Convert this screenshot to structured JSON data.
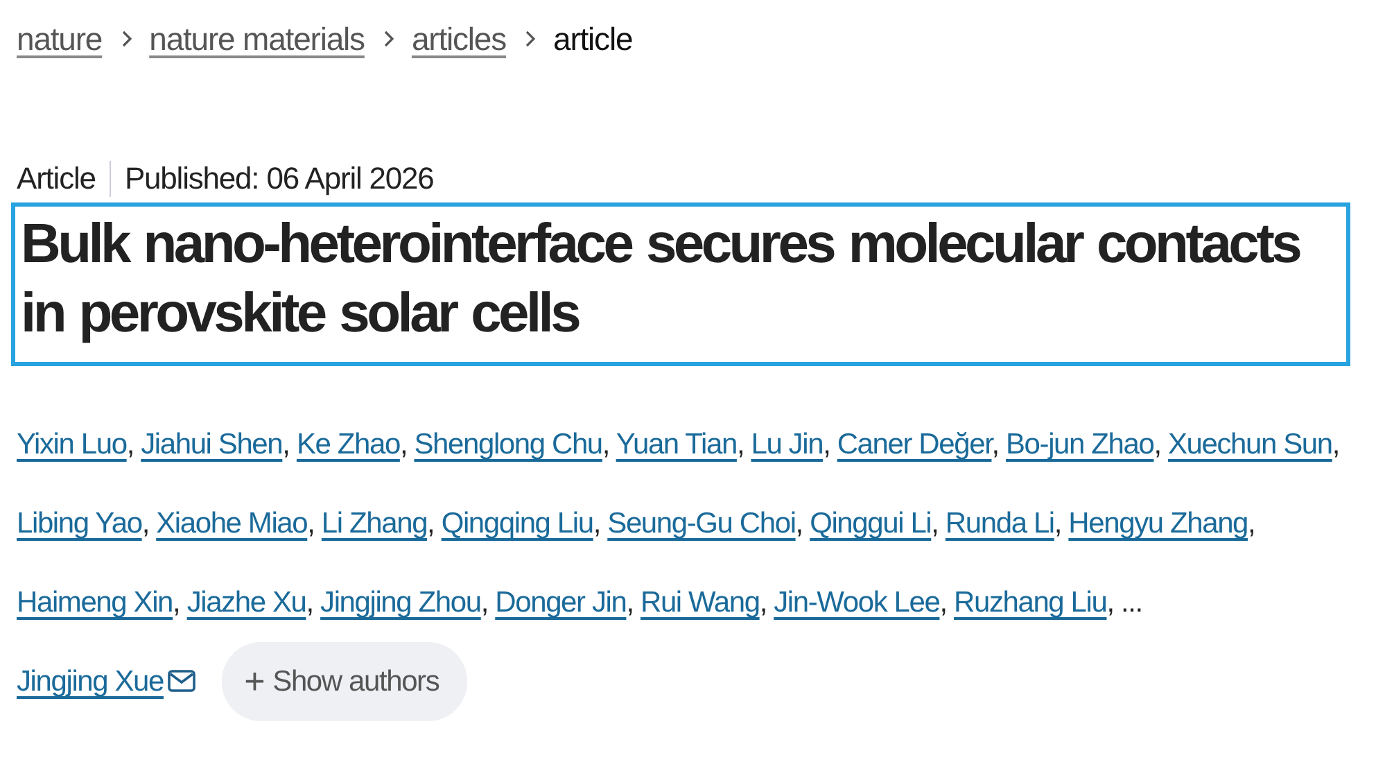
{
  "breadcrumb": [
    {
      "label": "nature",
      "link": true
    },
    {
      "label": "nature materials",
      "link": true
    },
    {
      "label": "articles",
      "link": true
    },
    {
      "label": "article",
      "link": false
    }
  ],
  "article": {
    "type": "Article",
    "published": "Published: 06 April 2026",
    "title": "Bulk nano-heterointerface secures molecular contacts in perovskite solar cells",
    "title_selected": true
  },
  "authors": [
    {
      "name": "Yixin Luo"
    },
    {
      "name": "Jiahui Shen"
    },
    {
      "name": "Ke Zhao"
    },
    {
      "name": "Shenglong Chu"
    },
    {
      "name": "Yuan Tian"
    },
    {
      "name": "Lu Jin"
    },
    {
      "name": "Caner Değer"
    },
    {
      "name": "Bo-jun Zhao"
    },
    {
      "name": "Xuechun Sun"
    },
    {
      "name": "Libing Yao"
    },
    {
      "name": "Xiaohe Miao"
    },
    {
      "name": "Li Zhang"
    },
    {
      "name": "Qingqing Liu"
    },
    {
      "name": "Seung-Gu Choi"
    },
    {
      "name": "Qinggui Li"
    },
    {
      "name": "Runda Li"
    },
    {
      "name": "Hengyu Zhang"
    },
    {
      "name": "Haimeng Xin"
    },
    {
      "name": "Jiazhe Xu"
    },
    {
      "name": "Jingjing Zhou"
    },
    {
      "name": "Donger Jin"
    },
    {
      "name": "Rui Wang"
    },
    {
      "name": "Jin-Wook Lee"
    },
    {
      "name": "Ruzhang Liu"
    }
  ],
  "author_separator": ",",
  "authors_more": "...",
  "last_author": {
    "name": "Jingjing Xue",
    "corresponding": true
  },
  "show_authors_button": {
    "icon": "+",
    "label": "Show authors"
  }
}
